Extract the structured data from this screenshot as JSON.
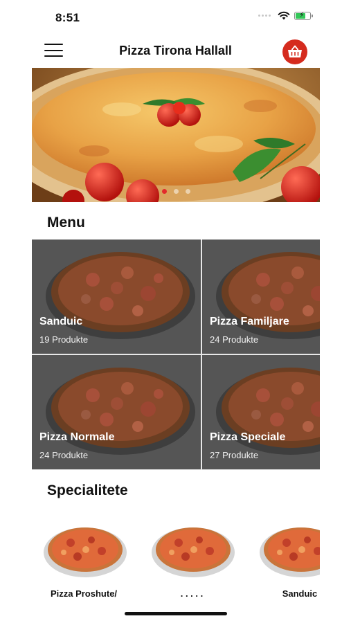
{
  "status_bar": {
    "time": "8:51",
    "icons": [
      "signal-dots-icon",
      "wifi-icon",
      "battery-charging-icon"
    ]
  },
  "nav": {
    "title": "Pizza Tirona Hallall",
    "menu_icon": "hamburger-menu-icon",
    "cart_icon": "basket-icon"
  },
  "hero": {
    "slide_count": 3,
    "active_slide": 1
  },
  "menu": {
    "title": "Menu",
    "categories": [
      {
        "name": "Sanduic",
        "count": "19 Produkte"
      },
      {
        "name": "Pizza Familjare",
        "count": "24 Produkte"
      },
      {
        "name": "Pizza Normale",
        "count": "24 Produkte"
      },
      {
        "name": "Pizza Speciale",
        "count": "27 Produkte"
      }
    ]
  },
  "specialties": {
    "title": "Specialitete",
    "items": [
      {
        "name": "Pizza Proshute/"
      },
      {
        "name": ". . . . ."
      },
      {
        "name": "Sanduic"
      }
    ]
  },
  "colors": {
    "accent": "#d52b1e",
    "tile_overlay": "#555555",
    "page_background": "#ffffff"
  }
}
